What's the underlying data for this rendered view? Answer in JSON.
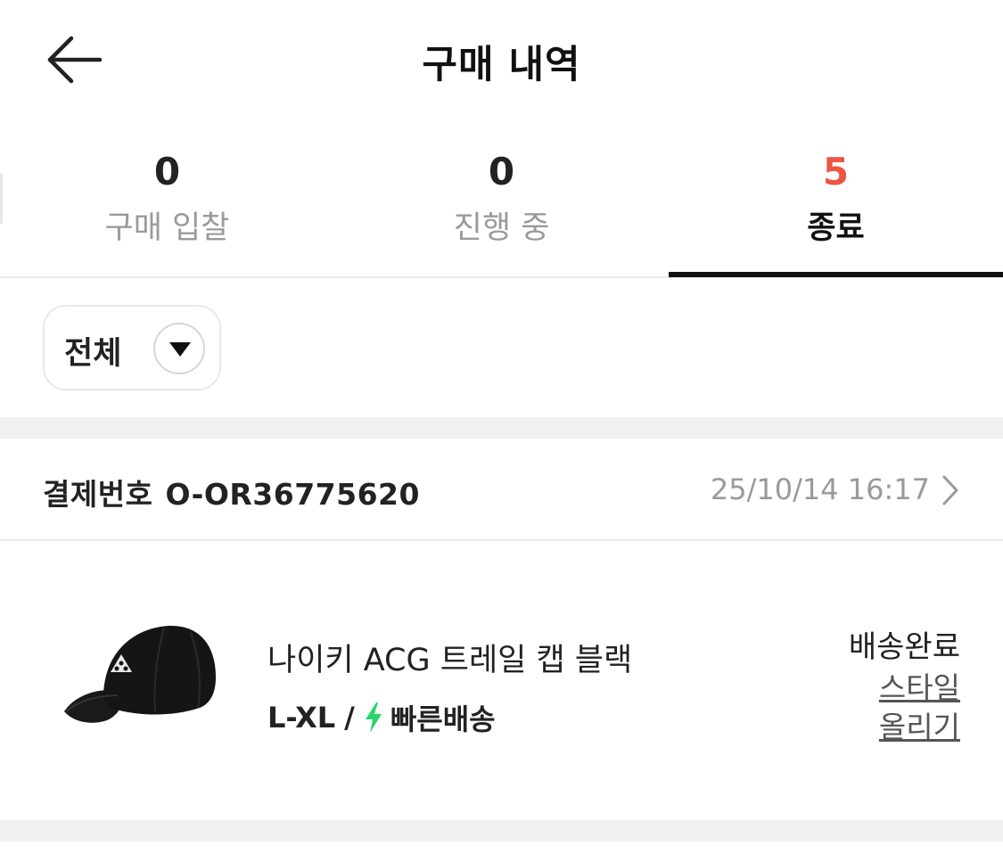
{
  "header": {
    "title": "구매 내역"
  },
  "tabs": [
    {
      "count": "0",
      "label": "구매 입찰"
    },
    {
      "count": "0",
      "label": "진행 중"
    },
    {
      "count": "5",
      "label": "종료"
    }
  ],
  "filter": {
    "label": "전체"
  },
  "order": {
    "number_label": "결제번호",
    "number": "O-OR36775620",
    "date": "25/10/14 16:17"
  },
  "product": {
    "name": "나이키 ACG 트레일 캡 블랙",
    "size": "L-XL",
    "separator": "/",
    "shipping": "빠른배송",
    "status": "배송완료",
    "style_link": "스타일 올리기"
  },
  "colors": {
    "accent_count": "#ec5445",
    "fast_shipping": "#2bd46a",
    "indicator": "#111111"
  },
  "icons": {
    "back": "arrow-left-icon",
    "filter": "caret-down-icon",
    "order": "chevron-right-icon",
    "shipping": "lightning-bolt-icon"
  }
}
